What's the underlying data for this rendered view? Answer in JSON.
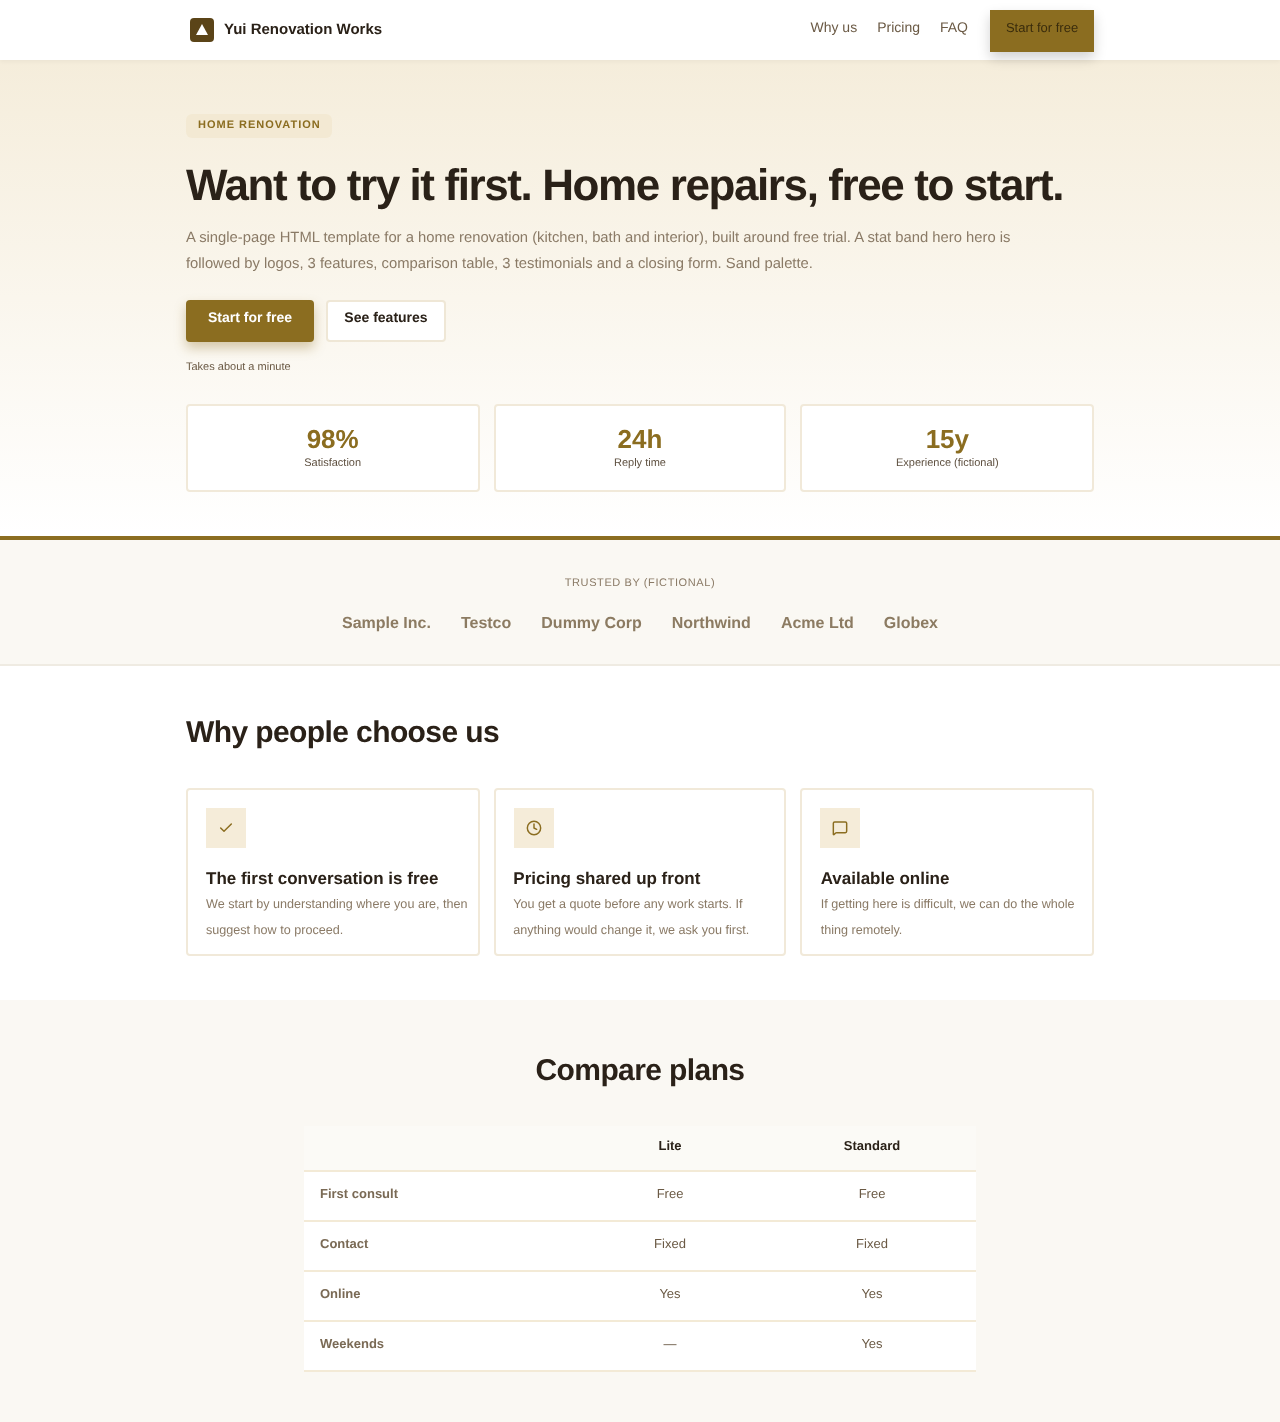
{
  "header": {
    "brand": "Yui Renovation Works",
    "nav": [
      {
        "label": "Why us"
      },
      {
        "label": "Pricing"
      },
      {
        "label": "FAQ"
      }
    ],
    "cta": "Start for free"
  },
  "hero": {
    "eyebrow": "HOME RENOVATION",
    "title": "Want to try it first. Home repairs, free to start.",
    "lead": "A single-page HTML template for a home renovation (kitchen, bath and interior), built around free trial. A stat band hero hero is followed by logos, 3 features, comparison table, 3 testimonials and a closing form. Sand palette.",
    "buttons": [
      {
        "label": "Start for free",
        "kind": "primary"
      },
      {
        "label": "See features",
        "kind": "secondary"
      }
    ],
    "note": "Takes about a minute",
    "stats": [
      {
        "value": "98%",
        "label": "Satisfaction"
      },
      {
        "value": "24h",
        "label": "Reply time"
      },
      {
        "value": "15y",
        "label": "Experience (fictional)"
      }
    ]
  },
  "logos": {
    "caption": "TRUSTED BY (FICTIONAL)",
    "items": [
      "Sample Inc.",
      "Testco",
      "Dummy Corp",
      "Northwind",
      "Acme Ltd",
      "Globex"
    ]
  },
  "features": {
    "title": "Why people choose us",
    "items": [
      {
        "title": "The first conversation is free",
        "text": "We start by understanding where you are, then suggest how to proceed."
      },
      {
        "title": "Pricing shared up front",
        "text": "You get a quote before any work starts. If anything would change it, we ask you first."
      },
      {
        "title": "Available online",
        "text": "If getting here is difficult, we can do the whole thing remotely."
      }
    ]
  },
  "compare": {
    "title": "Compare plans",
    "columns": [
      "Lite",
      "Standard"
    ],
    "rows": [
      {
        "label": "First consult",
        "cells": [
          "Free",
          "Free"
        ]
      },
      {
        "label": "Contact",
        "cells": [
          "Fixed",
          "Fixed"
        ]
      },
      {
        "label": "Online",
        "cells": [
          "Yes",
          "Yes"
        ]
      },
      {
        "label": "Weekends",
        "cells": [
          "—",
          "Yes"
        ]
      }
    ]
  }
}
